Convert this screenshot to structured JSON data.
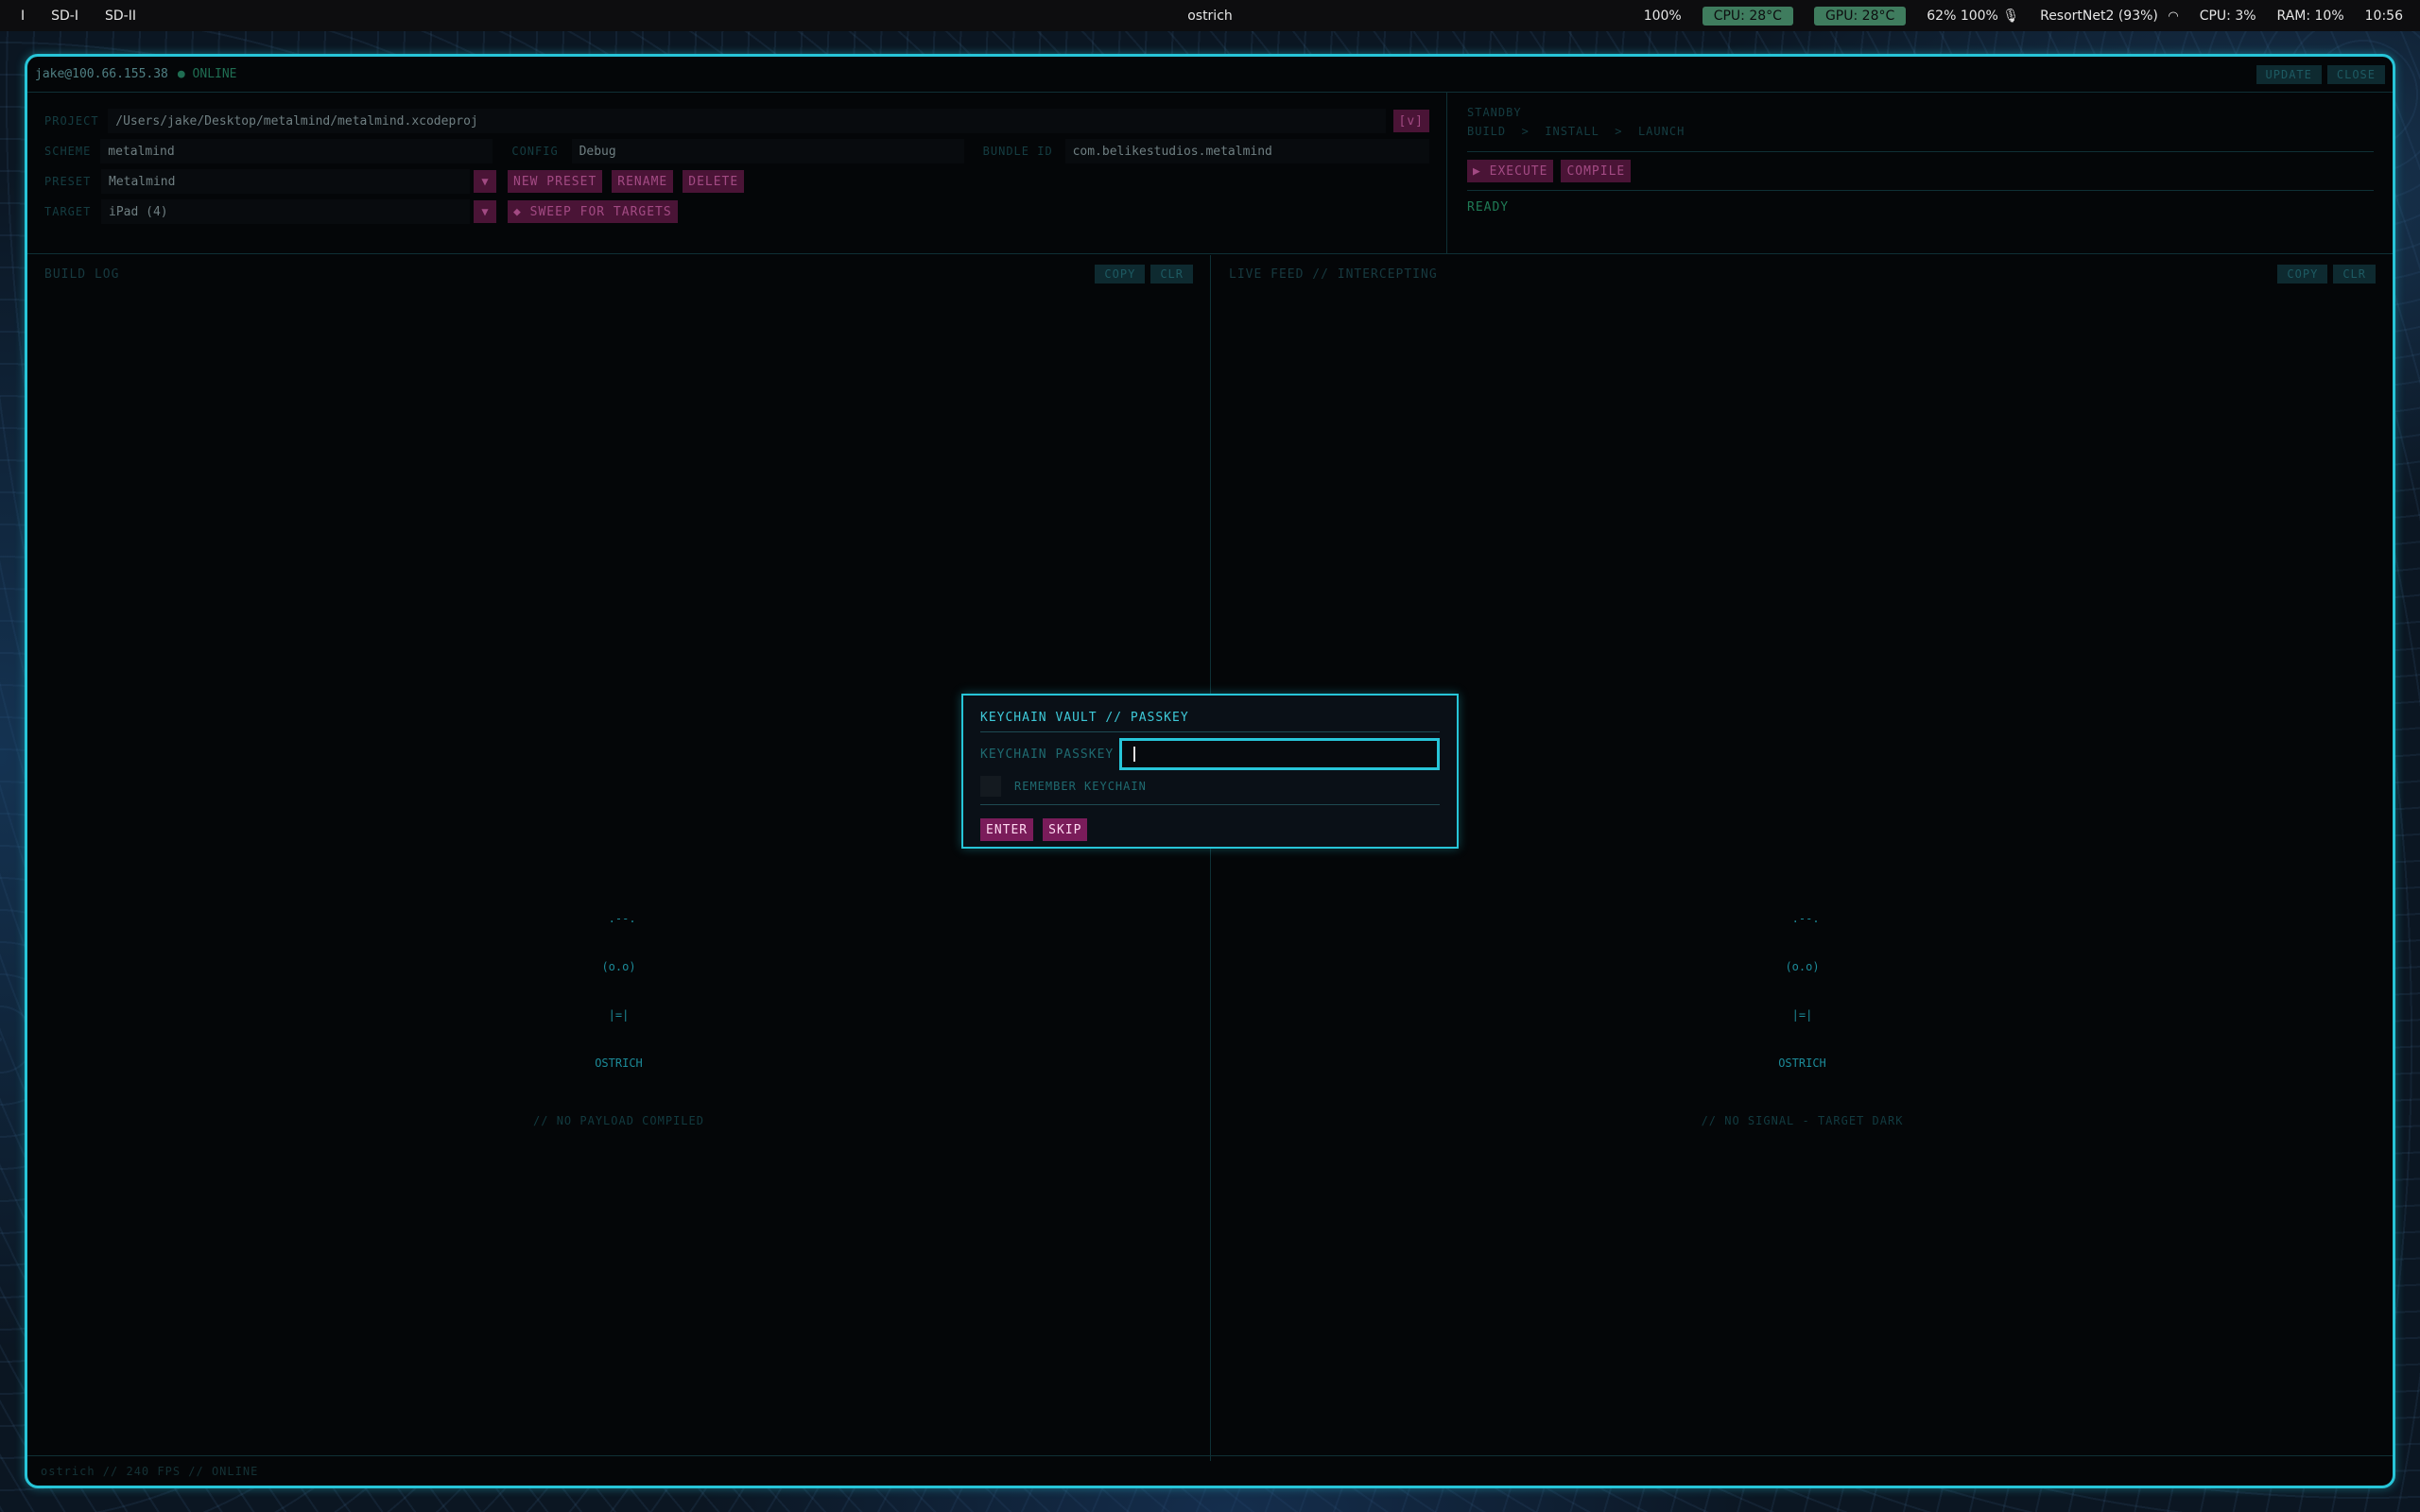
{
  "menubar": {
    "workspaces": [
      "I",
      "SD-I",
      "SD-II"
    ],
    "app_title": "ostrich",
    "brightness": "100%",
    "cpu_temp": "CPU: 28°C",
    "gpu_temp": "GPU: 28°C",
    "volume": "62%",
    "mic": "100%",
    "wifi": "ResortNet2 (93%)",
    "cpu": "CPU: 3%",
    "ram": "RAM: 10%",
    "clock": "10:56"
  },
  "titlebar": {
    "host": "jake@100.66.155.38",
    "status": "● ONLINE",
    "update_label": "UPDATE",
    "close_label": "CLOSE"
  },
  "config": {
    "project_label": "PROJECT",
    "project_path": "/Users/jake/Desktop/metalmind/metalmind.xcodeproj",
    "project_toggle": "[v]",
    "scheme_label": "SCHEME",
    "scheme_value": "metalmind",
    "config_label": "CONFIG",
    "config_value": "Debug",
    "bundle_label": "BUNDLE ID",
    "bundle_value": "com.belikestudios.metalmind",
    "preset_label": "PRESET",
    "preset_value": "Metalmind",
    "new_preset": "NEW PRESET",
    "rename": "RENAME",
    "delete": "DELETE",
    "target_label": "TARGET",
    "target_value": "iPad (4)",
    "sweep": "◆ SWEEP FOR TARGETS"
  },
  "status": {
    "state": "STANDBY",
    "pipeline": "BUILD  >  INSTALL  >  LAUNCH",
    "execute": "▶ EXECUTE",
    "compile": "COMPILE",
    "ready": "READY"
  },
  "build_log": {
    "title": "BUILD LOG",
    "copy": "COPY",
    "clear": "CLR",
    "mascot_line1": " .--.",
    "mascot_line2": "(o.o)",
    "mascot_line3": "|=|",
    "mascot_name": "OSTRICH",
    "note": "// NO PAYLOAD COMPILED"
  },
  "live_feed": {
    "title": "LIVE FEED // INTERCEPTING",
    "copy": "COPY",
    "clear": "CLR",
    "mascot_line1": " .--.",
    "mascot_line2": "(o.o)",
    "mascot_line3": "|=|",
    "mascot_name": "OSTRICH",
    "note": "// NO SIGNAL - TARGET DARK"
  },
  "footer": {
    "text": "ostrich // 240 FPS // ONLINE"
  },
  "modal": {
    "title": "KEYCHAIN VAULT // PASSKEY",
    "passkey_label": "KEYCHAIN PASSKEY",
    "passkey_value": "",
    "remember_label": "REMEMBER KEYCHAIN",
    "enter": "ENTER",
    "skip": "SKIP"
  },
  "colors": {
    "accent": "#27c5d8",
    "magenta": "#7a1c5a",
    "online_green": "#3f7c5e"
  }
}
